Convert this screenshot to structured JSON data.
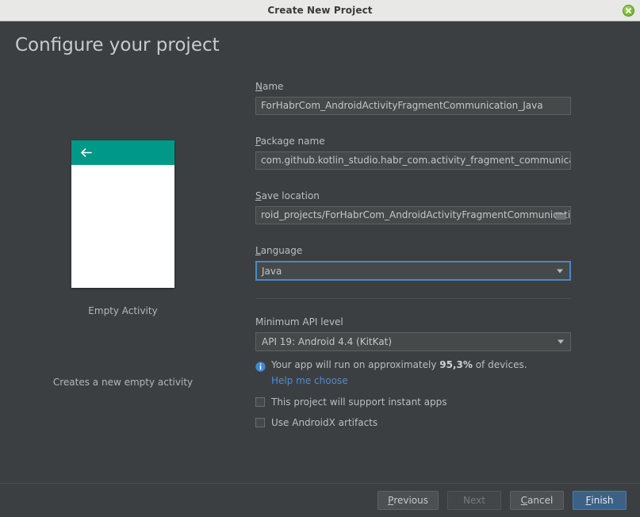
{
  "window": {
    "title": "Create New Project",
    "close_icon": "close-icon"
  },
  "page": {
    "heading": "Configure your project"
  },
  "preview": {
    "template_name": "Empty Activity",
    "template_description": "Creates a new empty activity",
    "appbar_color": "#009887",
    "back_icon": "back-arrow-icon"
  },
  "form": {
    "name": {
      "label_mnemonic": "N",
      "label_rest": "ame",
      "value": "ForHabrCom_AndroidActivityFragmentCommunication_Java"
    },
    "package_name": {
      "label_mnemonic": "P",
      "label_rest": "ackage name",
      "value": "com.github.kotlin_studio.habr_com.activity_fragment_communication_java"
    },
    "save_location": {
      "label_mnemonic": "S",
      "label_rest": "ave location",
      "value": "roid_projects/ForHabrCom_AndroidActivityFragmentCommunication_Java",
      "browse_icon": "folder-browse-icon"
    },
    "language": {
      "label_mnemonic": "L",
      "label_rest": "anguage",
      "value": "Java",
      "focused": true,
      "focus_color": "#4a88c7"
    },
    "min_api": {
      "label": "Minimum API level",
      "value": "API 19: Android 4.4 (KitKat)"
    },
    "device_info": {
      "icon": "info-icon",
      "prefix": "Your app will run on approximately ",
      "percent": "95,3%",
      "suffix": " of devices.",
      "link": "Help me choose",
      "link_color": "#4e8cd4"
    },
    "checkboxes": [
      {
        "label": "This project will support instant apps",
        "checked": false
      },
      {
        "label": "Use AndroidX artifacts",
        "checked": false
      }
    ]
  },
  "footer": {
    "previous": {
      "mnemonic": "P",
      "rest": "revious",
      "enabled": true
    },
    "next": {
      "label": "Next",
      "enabled": false
    },
    "cancel": {
      "mnemonic": "C",
      "rest": "ancel",
      "enabled": true
    },
    "finish": {
      "mnemonic": "F",
      "rest": "inish",
      "enabled": true,
      "primary": true,
      "color": "#3d6185"
    }
  }
}
